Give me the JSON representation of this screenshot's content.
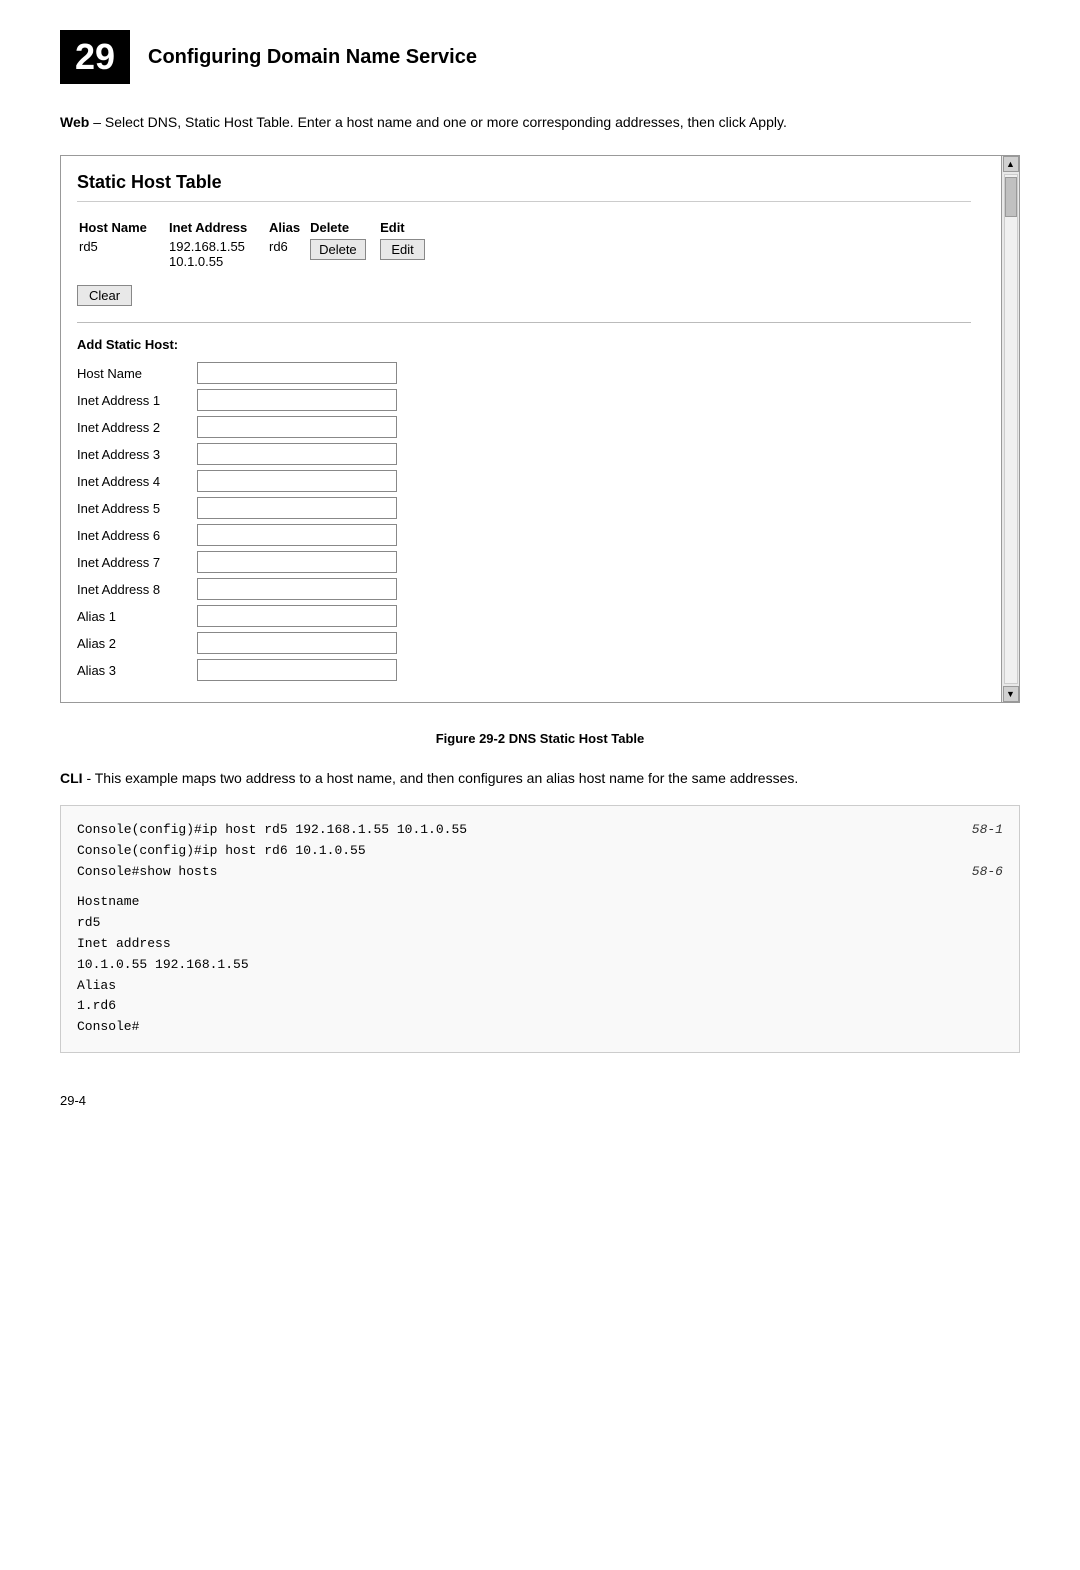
{
  "chapter": {
    "number": "29",
    "title": "Configuring Domain Name Service"
  },
  "intro": {
    "bold_part": "Web",
    "text": " – Select DNS, Static Host Table. Enter a host name and one or more corresponding addresses, then click Apply."
  },
  "panel": {
    "title": "Static Host Table",
    "table": {
      "headers": [
        "Host Name",
        "Inet Address",
        "Alias",
        "Delete",
        "Edit"
      ],
      "rows": [
        {
          "hostname": "rd5",
          "inet_address": "192.168.1.55\n10.1.0.55",
          "alias": "rd6",
          "delete_label": "Delete",
          "edit_label": "Edit"
        }
      ]
    },
    "clear_button": "Clear",
    "add_section": {
      "label": "Add Static Host:",
      "fields": [
        {
          "label": "Host Name",
          "name": "host-name"
        },
        {
          "label": "Inet Address 1",
          "name": "inet-address-1"
        },
        {
          "label": "Inet Address 2",
          "name": "inet-address-2"
        },
        {
          "label": "Inet Address 3",
          "name": "inet-address-3"
        },
        {
          "label": "Inet Address 4",
          "name": "inet-address-4"
        },
        {
          "label": "Inet Address 5",
          "name": "inet-address-5"
        },
        {
          "label": "Inet Address 6",
          "name": "inet-address-6"
        },
        {
          "label": "Inet Address 7",
          "name": "inet-address-7"
        },
        {
          "label": "Inet Address 8",
          "name": "inet-address-8"
        },
        {
          "label": "Alias 1",
          "name": "alias-1"
        },
        {
          "label": "Alias 2",
          "name": "alias-2"
        },
        {
          "label": "Alias 3",
          "name": "alias-3"
        }
      ]
    }
  },
  "figure_caption": "Figure 29-2  DNS Static Host Table",
  "cli_section": {
    "bold_part": "CLI",
    "text": " - This example maps two address to a host name, and then configures an alias host name for the same addresses.",
    "code_lines": [
      {
        "text": "Console(config)#ip host rd5 192.168.1.55 10.1.0.55",
        "ref": "58-1"
      },
      {
        "text": "Console(config)#ip host rd6 10.1.0.55",
        "ref": ""
      },
      {
        "text": "Console#show hosts",
        "ref": "58-6"
      },
      {
        "text": "",
        "ref": ""
      },
      {
        "text": "Hostname",
        "ref": ""
      },
      {
        "text": " rd5",
        "ref": ""
      },
      {
        "text": "Inet address",
        "ref": ""
      },
      {
        "text": " 10.1.0.55 192.168.1.55",
        "ref": ""
      },
      {
        "text": "Alias",
        "ref": ""
      },
      {
        "text": " 1.rd6",
        "ref": ""
      },
      {
        "text": "Console#",
        "ref": ""
      }
    ]
  },
  "page_number": "29-4"
}
